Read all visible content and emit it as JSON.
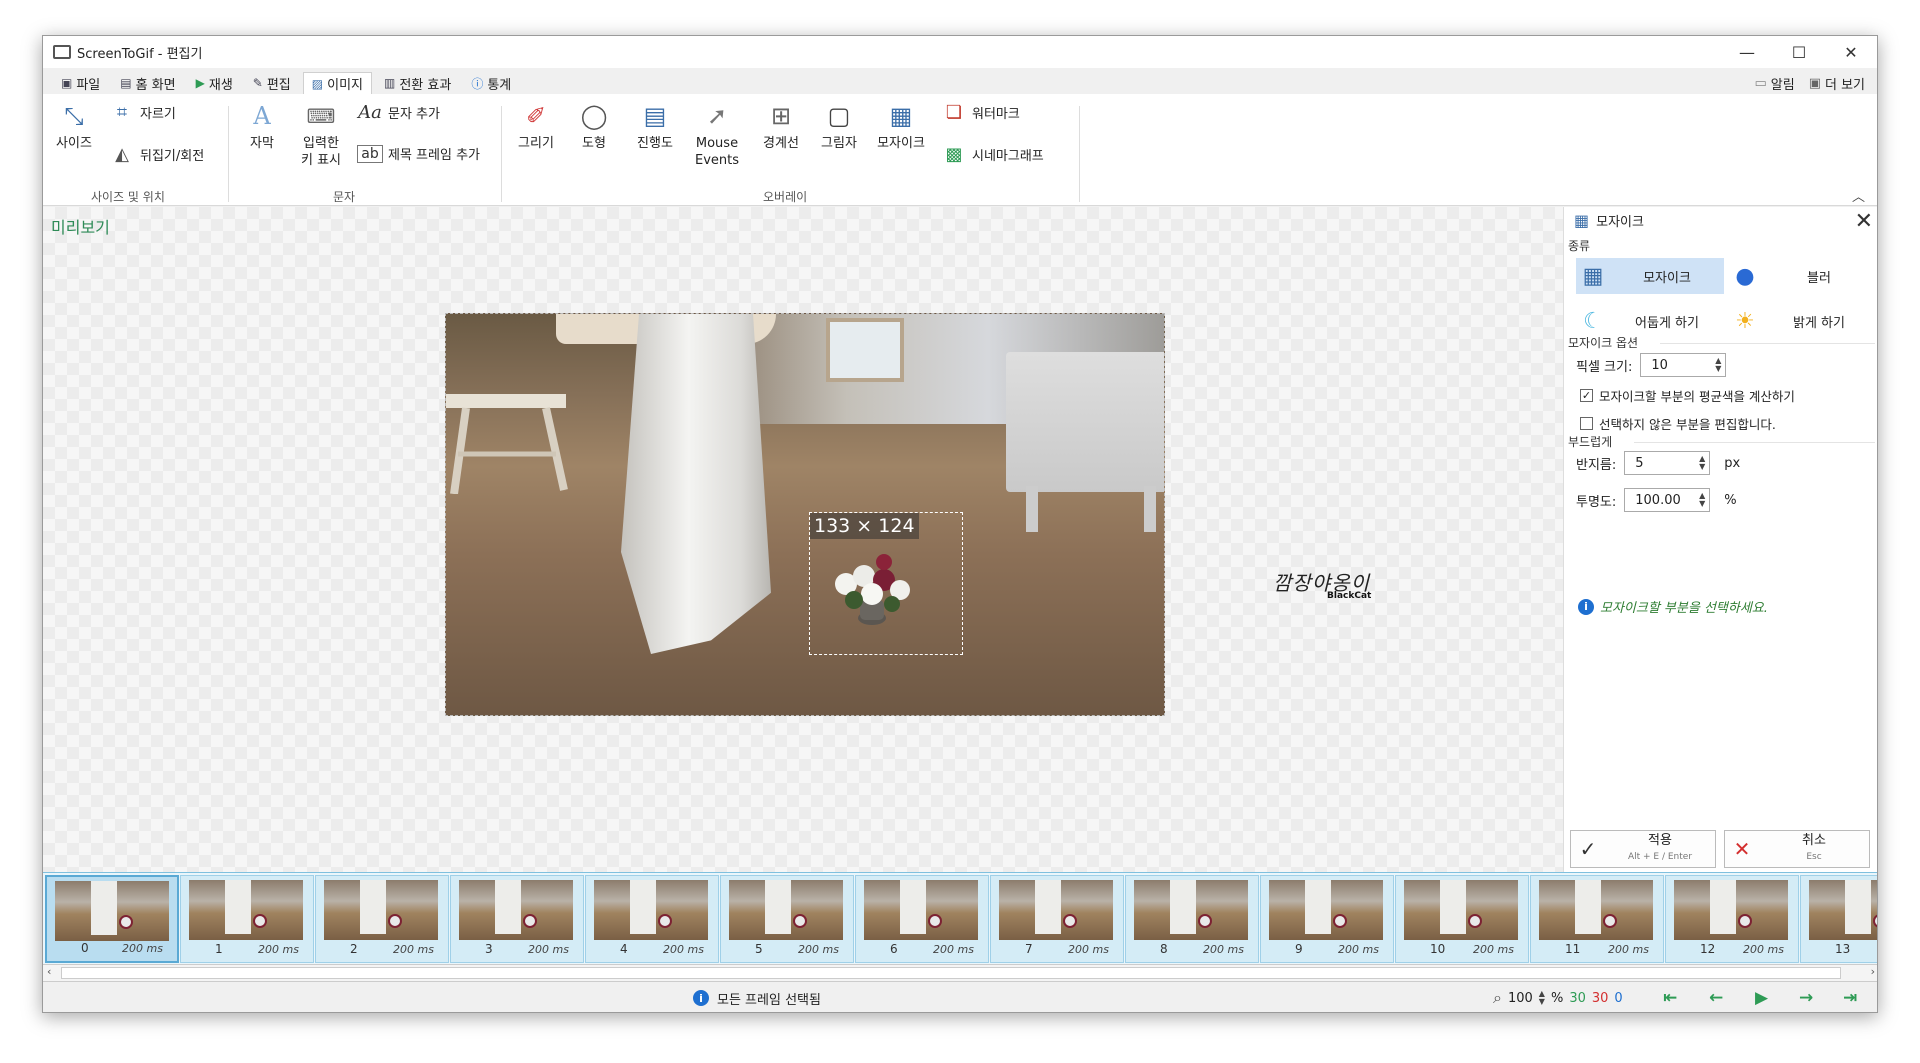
{
  "window": {
    "title": "ScreenToGif - 편집기",
    "minimize": "—",
    "maximize": "☐",
    "close": "✕"
  },
  "tabs": [
    {
      "label": "파일",
      "icon": "save-icon"
    },
    {
      "label": "홈 화면",
      "icon": "home-icon"
    },
    {
      "label": "재생",
      "icon": "play-icon"
    },
    {
      "label": "편집",
      "icon": "pencil-icon"
    },
    {
      "label": "이미지",
      "icon": "image-icon",
      "active": true
    },
    {
      "label": "전환 효과",
      "icon": "transition-icon"
    },
    {
      "label": "통계",
      "icon": "info-icon"
    }
  ],
  "topright": {
    "notifications": "알림",
    "more": "더 보기"
  },
  "ribbon": {
    "size": "사이즈",
    "crop": "자르기",
    "flip": "뒤집기/회전",
    "group_size": "사이즈 및 위치",
    "caption": "자막",
    "keystrokes": "입력한\n키 표시",
    "free_text": "문자 추가",
    "title_frame": "제목 프레임 추가",
    "group_text": "문자",
    "draw": "그리기",
    "shape": "도형",
    "progress": "진행도",
    "mouse": "Mouse\nEvents",
    "border": "경계선",
    "shadow": "그림자",
    "mosaic": "모자이크",
    "watermark": "워터마크",
    "cinemagraph": "시네마그래프",
    "group_overlay": "오버레이"
  },
  "preview": {
    "label": "미리보기",
    "selection": "133 × 124",
    "watermark": "깜장야옹이",
    "watermark_sub": "BlackCat"
  },
  "panel": {
    "title": "모자이크",
    "type_label": "종류",
    "types": {
      "mosaic": "모자이크",
      "blur": "블러",
      "darken": "어둡게 하기",
      "lighten": "밝게 하기"
    },
    "options_label": "모자이크 옵션",
    "pixel_size_label": "픽셀 크기:",
    "pixel_size": "10",
    "avg_color": "모자이크할 부분의 평균색을 계산하기",
    "avg_color_checked": "✓",
    "invert": "선택하지 않은 부분을 편집합니다.",
    "smooth_label": "부드럽게",
    "radius_label": "반지름:",
    "radius": "5",
    "radius_unit": "px",
    "opacity_label": "투명도:",
    "opacity": "100.00",
    "opacity_unit": "%",
    "hint": "모자이크할 부분을 선택하세요.",
    "apply": "적용",
    "apply_shortcut": "Alt + E / Enter",
    "cancel": "취소",
    "cancel_shortcut": "Esc"
  },
  "frames": [
    {
      "n": "0",
      "ms": "200 ms"
    },
    {
      "n": "1",
      "ms": "200 ms"
    },
    {
      "n": "2",
      "ms": "200 ms"
    },
    {
      "n": "3",
      "ms": "200 ms"
    },
    {
      "n": "4",
      "ms": "200 ms"
    },
    {
      "n": "5",
      "ms": "200 ms"
    },
    {
      "n": "6",
      "ms": "200 ms"
    },
    {
      "n": "7",
      "ms": "200 ms"
    },
    {
      "n": "8",
      "ms": "200 ms"
    },
    {
      "n": "9",
      "ms": "200 ms"
    },
    {
      "n": "10",
      "ms": "200 ms"
    },
    {
      "n": "11",
      "ms": "200 ms"
    },
    {
      "n": "12",
      "ms": "200 ms"
    },
    {
      "n": "13",
      "ms": ""
    }
  ],
  "status": {
    "message": "모든 프레임 선택됨",
    "zoom": "100",
    "zoom_unit": "%",
    "count_total": "30",
    "count_selected": "30",
    "count_current": "0"
  },
  "colors": {
    "accent": "#2e8b57",
    "selected": "#cfe2f6",
    "strip": "#eaf6fb",
    "counter_red": "#d32f2f"
  }
}
